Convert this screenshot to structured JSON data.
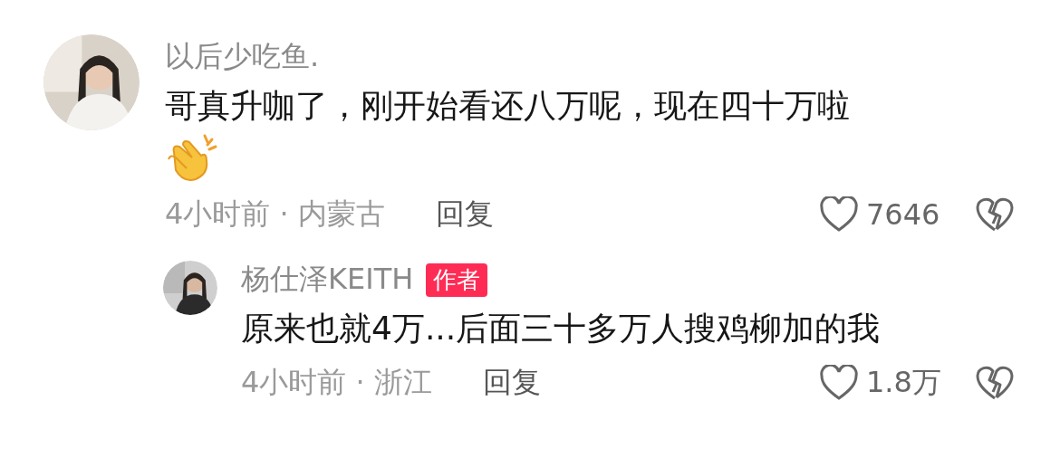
{
  "comment": {
    "username": "以后少吃鱼.",
    "text": "哥真升咖了，刚开始看还八万呢，现在四十万啦",
    "clap_emoji": true,
    "time_location": "4小时前 · 内蒙古",
    "reply_label": "回复",
    "liked": false,
    "likes": "7646",
    "reply": {
      "username": "杨仕泽KEITH",
      "author_badge": "作者",
      "text": "原来也就4万...后面三十多万人搜鸡柳加的我",
      "clap_emoji": false,
      "time_location": "4小时前 · 浙江",
      "reply_label": "回复",
      "liked": false,
      "likes": "1.8万"
    }
  }
}
